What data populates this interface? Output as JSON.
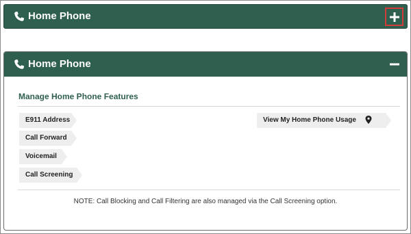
{
  "collapsed_panel": {
    "title": "Home Phone",
    "expand_icon": "plus-icon"
  },
  "expanded_panel": {
    "title": "Home Phone",
    "collapse_icon": "minus-icon",
    "section_title": "Manage Home Phone Features",
    "features_left": [
      {
        "label": "E911 Address"
      },
      {
        "label": "Call Forward"
      },
      {
        "label": "Voicemail"
      },
      {
        "label": "Call Screening"
      }
    ],
    "features_right": [
      {
        "label": "View My Home Phone Usage",
        "icon": "map-pin-icon"
      }
    ],
    "note": "NOTE: Call Blocking and Call Filtering are also managed via the Call Screening option."
  },
  "colors": {
    "header_green": "#2f5f4f",
    "highlight_red": "#d33b3b",
    "feature_bg": "#eeeeee"
  }
}
